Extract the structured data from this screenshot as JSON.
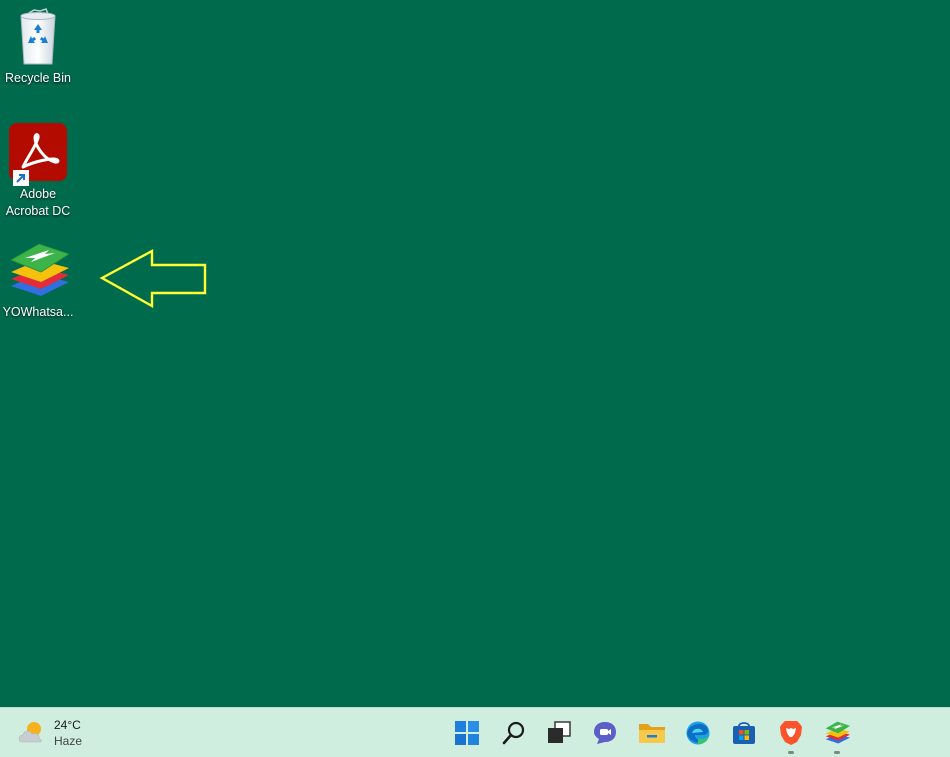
{
  "desktop": {
    "background": "#006a4d",
    "icons": [
      {
        "label": "Recycle Bin",
        "icon": "recycle-bin-icon"
      },
      {
        "label": "Adobe Acrobat DC",
        "icon": "adobe-acrobat-icon",
        "shortcut": true
      },
      {
        "label": "YOWhatsa...",
        "icon": "bluestacks-icon"
      }
    ],
    "annotation": {
      "icon": "yellow-arrow-left",
      "color": "#ffff33"
    }
  },
  "taskbar": {
    "background": "#cfeee0",
    "weather": {
      "temperature": "24°C",
      "condition": "Haze",
      "icon": "partly-cloudy-icon"
    },
    "apps": [
      {
        "name": "Start",
        "icon": "windows-start-icon"
      },
      {
        "name": "Search",
        "icon": "search-icon"
      },
      {
        "name": "Task View",
        "icon": "task-view-icon"
      },
      {
        "name": "Chat",
        "icon": "teams-chat-icon"
      },
      {
        "name": "File Explorer",
        "icon": "file-explorer-icon"
      },
      {
        "name": "Microsoft Edge",
        "icon": "edge-icon"
      },
      {
        "name": "Microsoft Store",
        "icon": "store-icon"
      },
      {
        "name": "Brave",
        "icon": "brave-icon",
        "running": true
      },
      {
        "name": "BlueStacks",
        "icon": "bluestacks-icon",
        "running": true
      }
    ]
  }
}
